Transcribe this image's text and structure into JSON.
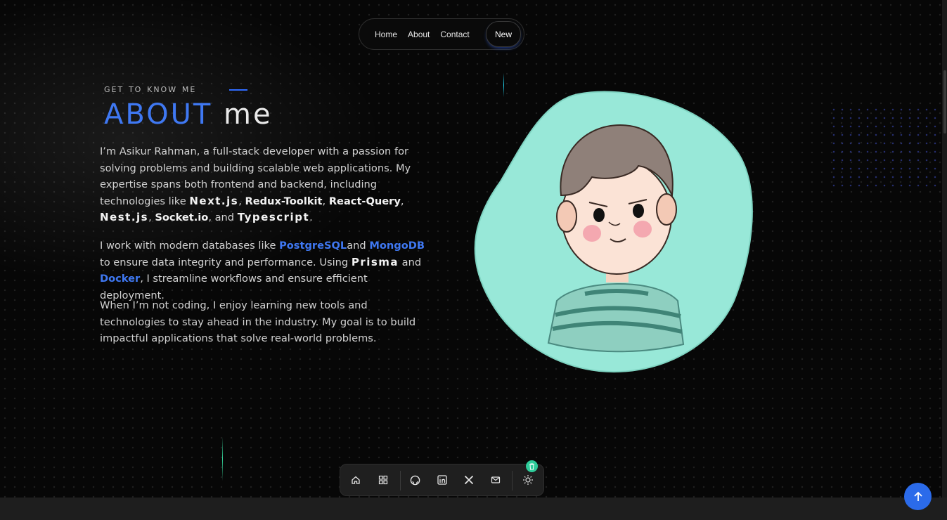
{
  "nav": {
    "items": [
      "Home",
      "About",
      "Contact"
    ],
    "new_label": "New"
  },
  "about": {
    "eyebrow": "get to know me",
    "title_about": "ABOUT",
    "title_me": "me",
    "p1": {
      "intro": "I’m Asikur Rahman, a full-stack developer with a passion for solving problems and building scalable web applications. My expertise spans both frontend and backend, including technologies like ",
      "tech1": "Next.js",
      "sep1": ", ",
      "tech2": "Redux-Toolkit",
      "sep2": ", ",
      "tech3": "React-Query",
      "sep3": ", ",
      "tech4": "Nest.js",
      "sep4": ", ",
      "tech5": "Socket.io",
      "sep5": ", and ",
      "tech6": "Typescript",
      "end": "."
    },
    "p2": {
      "intro": "I work with modern databases like ",
      "db1": "PostgreSQL",
      "mid": "and ",
      "db2": "MongoDB",
      "mid2": " to ensure data integrity and performance. Using ",
      "tool1": "Prisma",
      "mid3": " and ",
      "tool2": "Docker",
      "end": ", I streamline workflows and ensure efficient deployment."
    },
    "p3": "When I’m not coding, I enjoy learning new tools and technologies to stay ahead in the industry. My goal is to build impactful applications that solve real-world problems."
  },
  "dock": {
    "icons": [
      "home-icon",
      "grid-icon",
      "github-icon",
      "linkedin-icon",
      "x-icon",
      "mail-icon",
      "sun-icon"
    ],
    "badge_icon": "trash-icon"
  },
  "colors": {
    "accent": "#3f78f2",
    "avatar_blob": "#98e8d8",
    "badge": "#2ecc9a"
  }
}
